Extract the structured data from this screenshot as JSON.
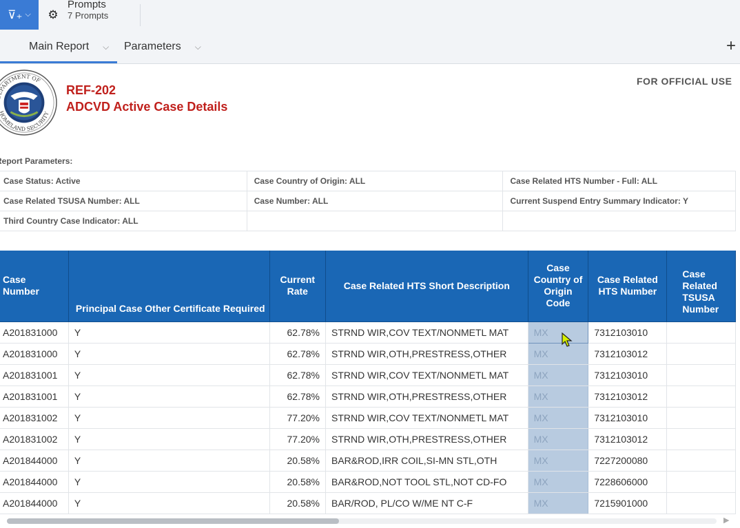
{
  "toolbar": {
    "filter_icon": "filter-add-icon",
    "prompts_title": "Prompts",
    "prompts_count": "7 Prompts"
  },
  "tabs": [
    {
      "label": "Main Report",
      "active": true
    },
    {
      "label": "Parameters",
      "active": false
    }
  ],
  "add_tab_label": "+",
  "report": {
    "code": "REF-202",
    "title": "ADCVD Active Case Details",
    "official": "FOR OFFICIAL USE",
    "seal_text_top": "DEPARTMENT OF",
    "seal_text_bottom": "HOMELAND SECURITY"
  },
  "parameters": {
    "label": "Report Parameters:",
    "rows": [
      [
        "Case Status: Active",
        "Case Country of Origin: ALL",
        "Case Related HTS Number - Full: ALL"
      ],
      [
        "Case Related TSUSA Number: ALL",
        "Case Number: ALL",
        "Current Suspend Entry Summary Indicator: Y"
      ],
      [
        "Third Country Case Indicator: ALL",
        "",
        ""
      ]
    ]
  },
  "table": {
    "headers": [
      "Case Number",
      "Principal Case Other Certificate Required",
      "Current Rate",
      "Case Related HTS Short Description",
      "Case Country of Origin Code",
      "Case Related HTS Number",
      "Case Related TSUSA Number"
    ],
    "rows": [
      [
        "A201831000",
        "Y",
        "62.78%",
        "STRND WIR,COV TEXT/NONMETL MAT",
        "MX",
        "7312103010"
      ],
      [
        "A201831000",
        "Y",
        "62.78%",
        "STRND WIR,OTH,PRESTRESS,OTHER",
        "MX",
        "7312103012"
      ],
      [
        "A201831001",
        "Y",
        "62.78%",
        "STRND WIR,COV TEXT/NONMETL MAT",
        "MX",
        "7312103010"
      ],
      [
        "A201831001",
        "Y",
        "62.78%",
        "STRND WIR,OTH,PRESTRESS,OTHER",
        "MX",
        "7312103012"
      ],
      [
        "A201831002",
        "Y",
        "77.20%",
        "STRND WIR,COV TEXT/NONMETL MAT",
        "MX",
        "7312103010"
      ],
      [
        "A201831002",
        "Y",
        "77.20%",
        "STRND WIR,OTH,PRESTRESS,OTHER",
        "MX",
        "7312103012"
      ],
      [
        "A201844000",
        "Y",
        "20.58%",
        "BAR&ROD,IRR COIL,SI-MN STL,OTH",
        "MX",
        "7227200080"
      ],
      [
        "A201844000",
        "Y",
        "20.58%",
        "BAR&ROD,NOT TOOL STL,NOT CD-FO",
        "MX",
        "7228606000"
      ],
      [
        "A201844000",
        "Y",
        "20.58%",
        "BAR/ROD, PL/CO W/ME NT C-F",
        "MX",
        "7215901000"
      ]
    ]
  },
  "colors": {
    "accent": "#3a7bd5",
    "header_bg": "#1a67b5",
    "title_red": "#c0201c",
    "selected_column": "#b8cbe0"
  }
}
